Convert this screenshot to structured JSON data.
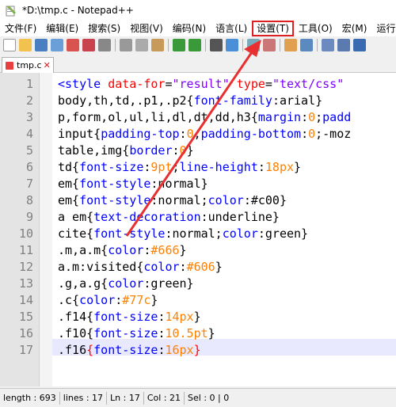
{
  "window": {
    "title": "*D:\\tmp.c - Notepad++"
  },
  "menu": [
    {
      "label": "文件(F)"
    },
    {
      "label": "编辑(E)"
    },
    {
      "label": "搜索(S)"
    },
    {
      "label": "视图(V)"
    },
    {
      "label": "编码(N)"
    },
    {
      "label": "语言(L)"
    },
    {
      "label": "设置(T)"
    },
    {
      "label": "工具(O)"
    },
    {
      "label": "宏(M)"
    },
    {
      "label": "运行(R)"
    }
  ],
  "tab": {
    "label": "tmp.c"
  },
  "editor": {
    "line_numbers": [
      "1",
      "2",
      "3",
      "4",
      "5",
      "6",
      "7",
      "8",
      "9",
      "10",
      "11",
      "12",
      "13",
      "14",
      "15",
      "16",
      "17"
    ],
    "current_line": 17
  },
  "status": {
    "length": "length : 693",
    "lines": "lines : 17",
    "ln": "Ln : 17",
    "col": "Col : 21",
    "sel": "Sel : 0 | 0"
  },
  "colors": {
    "highlight_box": "#e02020",
    "arrow": "#e83030"
  }
}
